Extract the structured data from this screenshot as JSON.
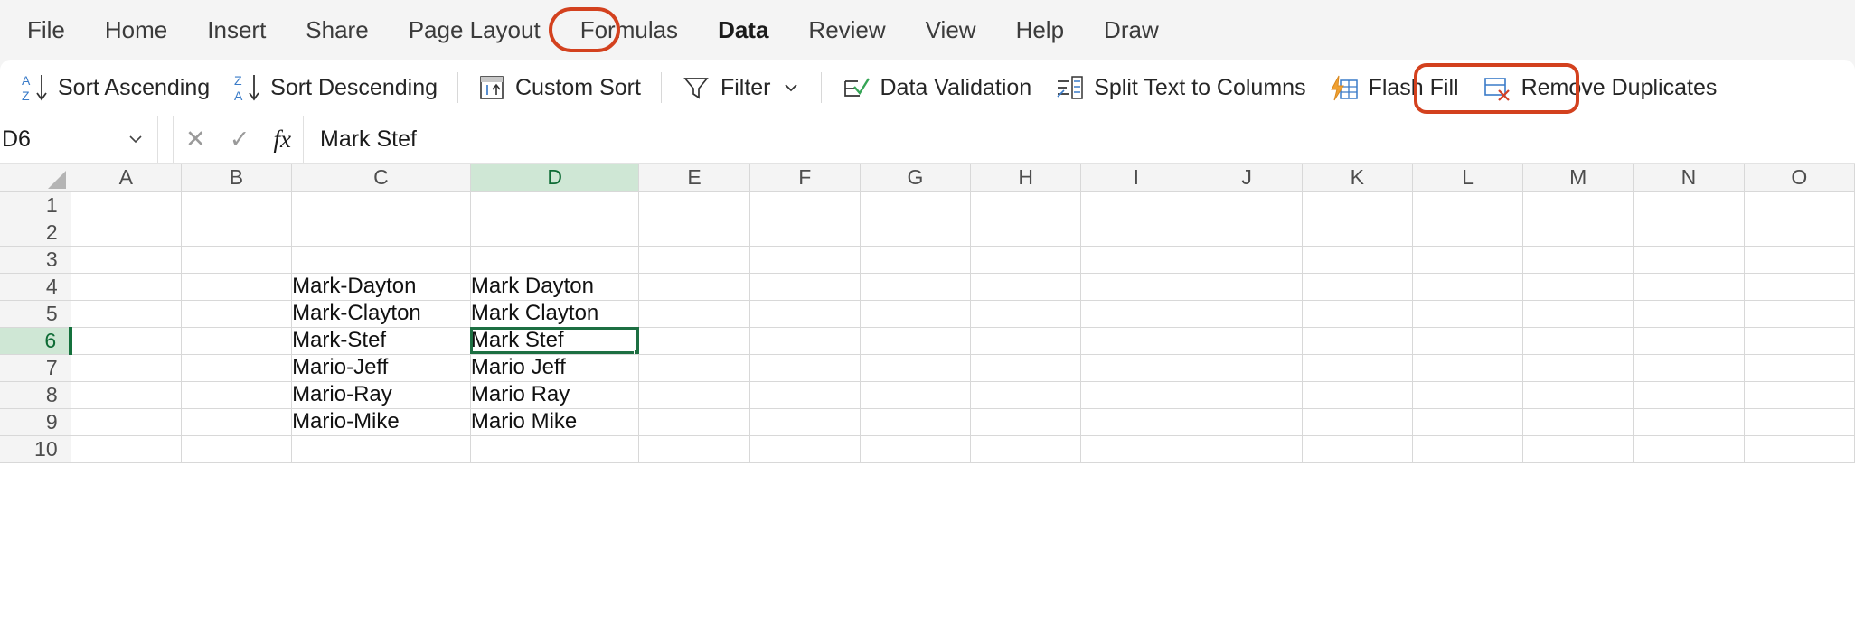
{
  "menu": {
    "items": [
      {
        "label": "File",
        "active": false
      },
      {
        "label": "Home",
        "active": false
      },
      {
        "label": "Insert",
        "active": false
      },
      {
        "label": "Share",
        "active": false
      },
      {
        "label": "Page Layout",
        "active": false
      },
      {
        "label": "Formulas",
        "active": false
      },
      {
        "label": "Data",
        "active": true
      },
      {
        "label": "Review",
        "active": false
      },
      {
        "label": "View",
        "active": false
      },
      {
        "label": "Help",
        "active": false
      },
      {
        "label": "Draw",
        "active": false
      }
    ],
    "highlight_color": "#d3411e",
    "highlighted_tab": "Data"
  },
  "ribbon": {
    "buttons": [
      {
        "label": "Sort Ascending",
        "icon": "sort-ascending-icon"
      },
      {
        "label": "Sort Descending",
        "icon": "sort-descending-icon"
      },
      {
        "label": "Custom Sort",
        "icon": "custom-sort-icon"
      },
      {
        "label": "Filter",
        "icon": "filter-icon",
        "has_chevron": true
      },
      {
        "label": "Data Validation",
        "icon": "data-validation-icon"
      },
      {
        "label": "Split Text to Columns",
        "icon": "split-text-to-columns-icon"
      },
      {
        "label": "Flash Fill",
        "icon": "flash-fill-icon",
        "highlighted": true
      },
      {
        "label": "Remove Duplicates",
        "icon": "remove-duplicates-icon"
      }
    ],
    "highlighted_button": "Flash Fill",
    "highlight_color": "#d3411e"
  },
  "formula_bar": {
    "name_box_value": "D6",
    "cancel_icon": "cancel-icon",
    "confirm_icon": "confirm-icon",
    "function_icon": "fx-icon",
    "formula_value": "Mark Stef"
  },
  "grid": {
    "columns": [
      "A",
      "B",
      "C",
      "D",
      "E",
      "F",
      "G",
      "H",
      "I",
      "J",
      "K",
      "L",
      "M",
      "N",
      "O"
    ],
    "selected_column": "D",
    "selected_row": 6,
    "selected_cell": "D6",
    "selection_color": "#1d6f42",
    "header_highlight_color": "#cfe7d5",
    "rows": [
      {
        "num": "1",
        "cells": {}
      },
      {
        "num": "2",
        "cells": {}
      },
      {
        "num": "3",
        "cells": {}
      },
      {
        "num": "4",
        "cells": {
          "C": "Mark-Dayton",
          "D": "Mark Dayton"
        }
      },
      {
        "num": "5",
        "cells": {
          "C": "Mark-Clayton",
          "D": "Mark Clayton"
        }
      },
      {
        "num": "6",
        "cells": {
          "C": "Mark-Stef",
          "D": "Mark Stef"
        }
      },
      {
        "num": "7",
        "cells": {
          "C": "Mario-Jeff",
          "D": "Mario Jeff"
        }
      },
      {
        "num": "8",
        "cells": {
          "C": "Mario-Ray",
          "D": "Mario Ray"
        }
      },
      {
        "num": "9",
        "cells": {
          "C": "Mario-Mike",
          "D": "Mario Mike"
        }
      },
      {
        "num": "10",
        "cells": {}
      }
    ]
  }
}
